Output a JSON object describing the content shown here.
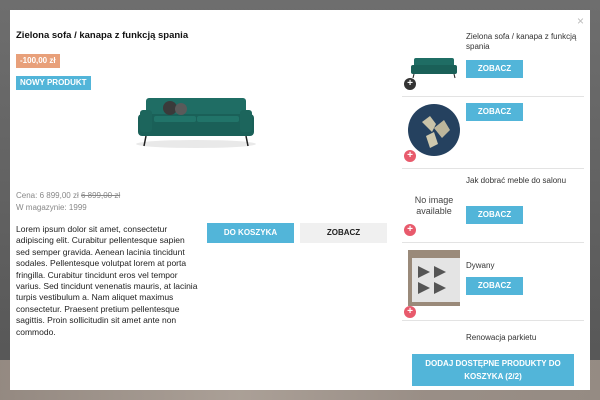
{
  "modal": {
    "close_label": "×",
    "title": "Zielona sofa / kanapa z funkcją spania",
    "discount_badge": "-100,00 zł",
    "new_badge": "NOWY PRODUKT",
    "price_label": "Cena:",
    "price_current": "6 899,00 zł",
    "price_old": "6 899,00 zł",
    "stock_label": "W magazynie:",
    "stock_value": "1999",
    "description": "Lorem ipsum dolor sit amet, consectetur adipiscing elit. Curabitur pellentesque sapien sed semper gravida. Aenean lacinia tincidunt sodales. Pellentesque volutpat lorem at porta fringilla. Curabitur tincidunt eros vel tempor varius. Sed tincidunt venenatis mauris, at lacinia turpis vestibulum a. Nam aliquet maximus consectetur. Praesent pretium pellentesque sagittis. Proin sollicitudin sit amet ante non commodo.",
    "add_to_cart_label": "DO KOSZYKA",
    "view_label": "ZOBACZ"
  },
  "colors": {
    "accent": "#52b5d9",
    "discount": "#e8a07a",
    "sofa": "#1e6b62",
    "add_circle": "#e85a6c"
  },
  "sidebar": {
    "items": [
      {
        "name": "Zielona sofa / kanapa z funkcją spania",
        "button": "ZOBACZ",
        "icon": "plus-dark-icon"
      },
      {
        "name": "",
        "button": "ZOBACZ",
        "icon": "plus-red-icon"
      },
      {
        "name": "Jak dobrać meble do salonu",
        "no_image": "No image available",
        "button": "ZOBACZ",
        "icon": "plus-red-icon"
      },
      {
        "name": "Dywany",
        "button": "ZOBACZ",
        "icon": "plus-red-icon"
      },
      {
        "name": "Renowacja parkietu"
      }
    ],
    "add_all_label": "DODAJ DOSTĘPNE PRODUKTY DO KOSZYKA (2/2)"
  }
}
